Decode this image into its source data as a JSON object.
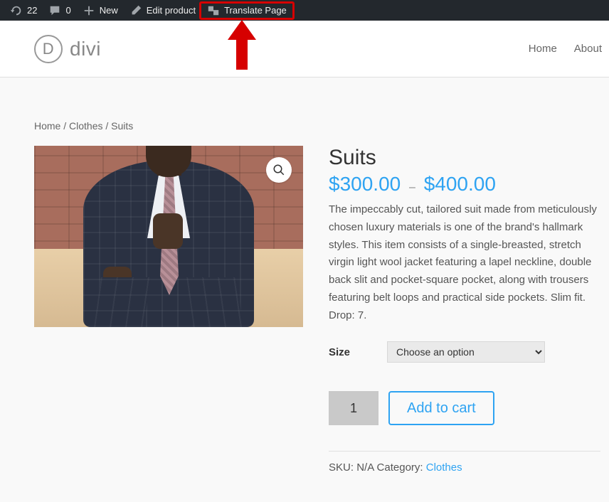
{
  "admin_bar": {
    "updates_count": "22",
    "comments_count": "0",
    "new_label": "New",
    "edit_product_label": "Edit product",
    "translate_label": "Translate Page"
  },
  "header": {
    "logo_letter": "D",
    "logo_text": "divi",
    "nav": {
      "home": "Home",
      "about": "About"
    }
  },
  "breadcrumb": {
    "text": "Home / Clothes / Suits"
  },
  "product": {
    "title": "Suits",
    "currency": "$",
    "price_low": "300.00",
    "price_sep": "–",
    "price_high": "400.00",
    "description": "The impeccably cut, tailored suit made from meticulously chosen luxury materials is one of the brand's hallmark styles. This item consists of a single-breasted, stretch virgin light wool jacket featuring a lapel neckline, double back slit and pocket-square pocket, along with trousers featuring belt loops and practical side pockets. Slim fit. Drop: 7.",
    "variation_label": "Size",
    "variation_placeholder": "Choose an option",
    "qty_value": "1",
    "add_to_cart_label": "Add to cart",
    "meta": {
      "sku_label": "SKU: ",
      "sku_value": "N/A",
      "category_label": " Category: ",
      "category_value": "Clothes"
    }
  }
}
